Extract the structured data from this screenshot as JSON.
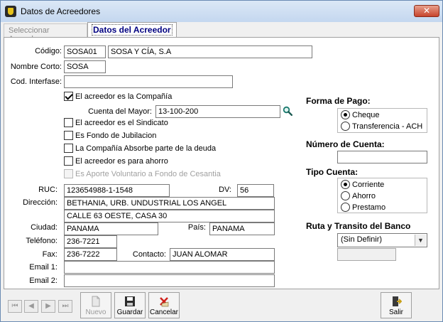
{
  "window": {
    "title": "Datos de Acreedores",
    "close_label": "✕"
  },
  "tabs": [
    {
      "label": "Seleccionar Acreedor"
    },
    {
      "label": "Datos del Acreedor"
    }
  ],
  "form": {
    "codigo": {
      "label": "Código:",
      "code": "SOSA01",
      "name": "SOSA Y CÍA, S.A"
    },
    "nombre_corto": {
      "label": "Nombre Corto:",
      "value": "SOSA"
    },
    "cod_interfase": {
      "label": "Cod. Interfase:",
      "value": ""
    },
    "checkboxes": [
      {
        "label": "El acreedor es la Compañía",
        "checked": true,
        "enabled": true
      },
      {
        "label": "El acreedor es el Sindicato",
        "checked": false,
        "enabled": true
      },
      {
        "label": "Es Fondo de Jubilacion",
        "checked": false,
        "enabled": true
      },
      {
        "label": "La Compañía Absorbe parte de la deuda",
        "checked": false,
        "enabled": true
      },
      {
        "label": "El acreedor es para ahorro",
        "checked": false,
        "enabled": true
      },
      {
        "label": "Es Aporte Voluntario a Fondo de Cesantia",
        "checked": false,
        "enabled": false
      }
    ],
    "cuenta_mayor": {
      "label": "Cuenta del Mayor:",
      "value": "13-100-200"
    },
    "ruc": {
      "label": "RUC:",
      "value": "123654988-1-1548"
    },
    "dv": {
      "label": "DV:",
      "value": "56"
    },
    "direccion": {
      "label": "Dirección:",
      "line1": "BETHANIA, URB. UNDUSTRIAL LOS ANGEL",
      "line2": "CALLE 63 OESTE, CASA 30"
    },
    "ciudad": {
      "label": "Ciudad:",
      "value": "PANAMA"
    },
    "pais": {
      "label": "País:",
      "value": "PANAMA"
    },
    "telefono": {
      "label": "Teléfono:",
      "value": "236-7221"
    },
    "fax": {
      "label": "Fax:",
      "value": "236-7222"
    },
    "contacto": {
      "label": "Contacto:",
      "value": "JUAN ALOMAR"
    },
    "email1": {
      "label": "Email 1:",
      "value": ""
    },
    "email2": {
      "label": "Email 2:",
      "value": ""
    }
  },
  "payment": {
    "forma_pago": {
      "title": "Forma de Pago:",
      "options": [
        "Cheque",
        "Transferencia - ACH"
      ],
      "selected": "Cheque"
    },
    "numero_cuenta": {
      "title": "Número de Cuenta:",
      "value": ""
    },
    "tipo_cuenta": {
      "title": "Tipo Cuenta:",
      "options": [
        "Corriente",
        "Ahorro",
        "Prestamo"
      ],
      "selected": "Corriente"
    },
    "ruta_banco": {
      "title": "Ruta y Transito del Banco",
      "selected": "(Sin Definir)",
      "code": ""
    }
  },
  "toolbar": {
    "nav": [
      "first",
      "prev",
      "next",
      "last"
    ],
    "nuevo": "Nuevo",
    "guardar": "Guardar",
    "cancelar": "Cancelar",
    "salir": "Salir"
  },
  "icons": {
    "search": "magnifier-icon",
    "save": "floppy-disk-icon",
    "cancel": "cancel-x-icon",
    "exit": "exit-door-icon",
    "new": "new-document-icon"
  }
}
